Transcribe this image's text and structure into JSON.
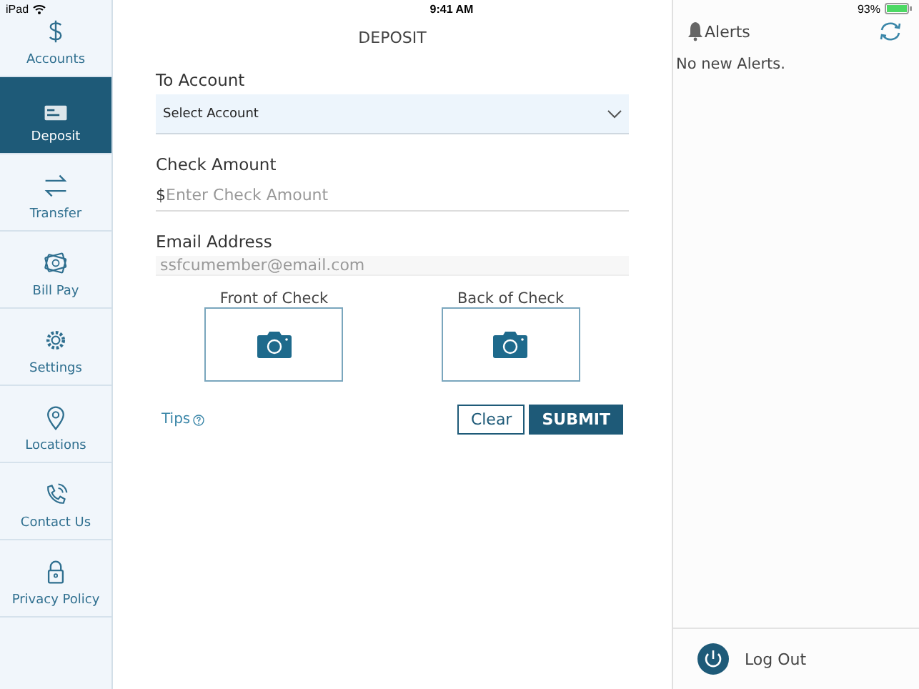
{
  "status_bar": {
    "device": "iPad",
    "time": "9:41 AM",
    "battery": "93%"
  },
  "sidebar": {
    "items": [
      {
        "label": "Accounts",
        "selected": false
      },
      {
        "label": "Deposit",
        "selected": true
      },
      {
        "label": "Transfer",
        "selected": false
      },
      {
        "label": "Bill Pay",
        "selected": false
      },
      {
        "label": "Settings",
        "selected": false
      },
      {
        "label": "Locations",
        "selected": false
      },
      {
        "label": "Contact Us",
        "selected": false
      },
      {
        "label": "Privacy Policy",
        "selected": false
      }
    ]
  },
  "page": {
    "title": "DEPOSIT"
  },
  "form": {
    "account": {
      "label": "To Account",
      "value": "Select Account"
    },
    "amount": {
      "label": "Check Amount",
      "prefix": "$",
      "placeholder": "Enter Check Amount"
    },
    "email": {
      "label": "Email Address",
      "placeholder": "ssfcumember@email.com"
    },
    "photos": [
      {
        "label": "Front of Check"
      },
      {
        "label": "Back of Check"
      }
    ],
    "tips": "Tips",
    "buttons": [
      {
        "label": "Clear",
        "kind": "secondary"
      },
      {
        "label": "SUBMIT",
        "kind": "primary"
      }
    ]
  },
  "alerts": {
    "title": "Alerts",
    "message": "No new Alerts."
  },
  "logout": {
    "label": "Log Out"
  }
}
